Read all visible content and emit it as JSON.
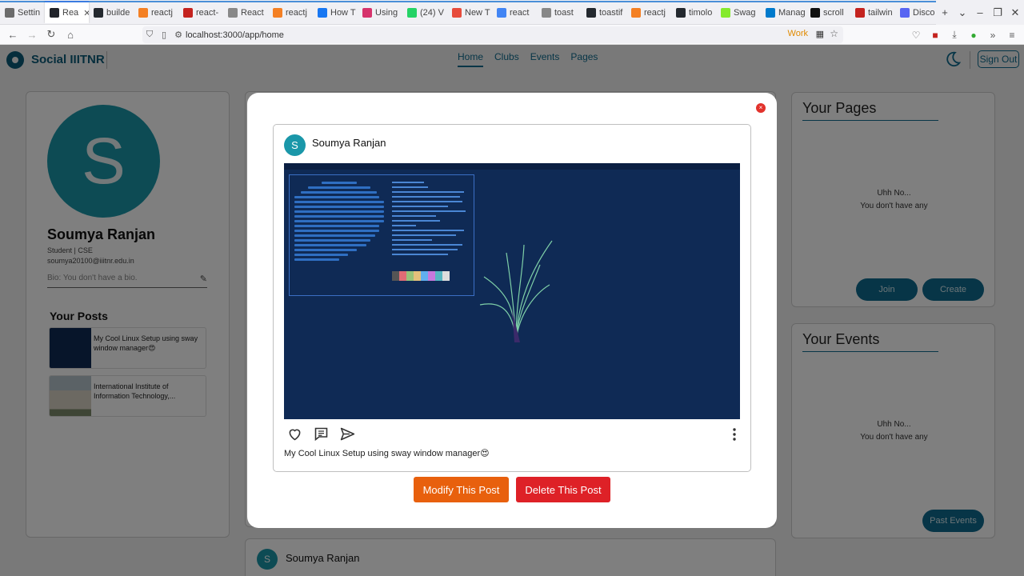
{
  "browser": {
    "tabs": [
      {
        "label": "Settin",
        "color": "#6b6b6b"
      },
      {
        "label": "Rea",
        "color": "#20232a",
        "active": true
      },
      {
        "label": "builde",
        "color": "#24292f"
      },
      {
        "label": "reactj",
        "color": "#f48024"
      },
      {
        "label": "react-",
        "color": "#c4231f"
      },
      {
        "label": "React",
        "color": "#888888"
      },
      {
        "label": "reactj",
        "color": "#f48024"
      },
      {
        "label": "How T",
        "color": "#1877f2"
      },
      {
        "label": "Using",
        "color": "#d6336c"
      },
      {
        "label": "(24) V",
        "color": "#25d366"
      },
      {
        "label": "New T",
        "color": "#e74c3c"
      },
      {
        "label": "react",
        "color": "#4285f4"
      },
      {
        "label": "toast",
        "color": "#888888"
      },
      {
        "label": "toastif",
        "color": "#24292f"
      },
      {
        "label": "reactj",
        "color": "#f48024"
      },
      {
        "label": "timolo",
        "color": "#24292f"
      },
      {
        "label": "Swag",
        "color": "#85ea2d"
      },
      {
        "label": "Manag",
        "color": "#007acc"
      },
      {
        "label": "scroll",
        "color": "#111111"
      },
      {
        "label": "tailwin",
        "color": "#c4231f"
      },
      {
        "label": "Disco",
        "color": "#5865f2"
      }
    ],
    "new_tab_label": "+",
    "url": "localhost:3000/app/home",
    "container_label": "Work"
  },
  "app": {
    "brand": "Social IIITNR",
    "nav": [
      "Home",
      "Clubs",
      "Events",
      "Pages"
    ],
    "active_nav": "Home",
    "sign_out": "Sign Out"
  },
  "profile": {
    "initial": "S",
    "name": "Soumya Ranjan",
    "role": "Student | CSE",
    "email": "soumya20100@iiitnr.edu.in",
    "bio_placeholder": "Bio: You don't have a bio.",
    "posts_title": "Your Posts",
    "posts": [
      {
        "caption": "My Cool Linux Setup using sway window manager😍"
      },
      {
        "caption": "International Institute of Information Technology,..."
      }
    ]
  },
  "side": {
    "pages": {
      "title": "Your Pages",
      "empty_line1": "Uhh No...",
      "empty_line2": "You don't have any",
      "join": "Join",
      "create": "Create"
    },
    "events": {
      "title": "Your Events",
      "empty_line1": "Uhh No...",
      "empty_line2": "You don't have any",
      "past": "Past Events"
    }
  },
  "feed": {
    "next_post_author": "Soumya Ranjan",
    "next_post_initial": "S"
  },
  "modal": {
    "close": "×",
    "post": {
      "initial": "S",
      "author": "Soumya Ranjan",
      "caption": "My Cool Linux Setup using sway window manager😍"
    },
    "modify": "Modify This Post",
    "delete": "Delete This Post"
  },
  "colors": {
    "accent": "#0e6b8e",
    "avatar": "#1a97a9",
    "modify": "#e8600d",
    "delete": "#de2127"
  }
}
